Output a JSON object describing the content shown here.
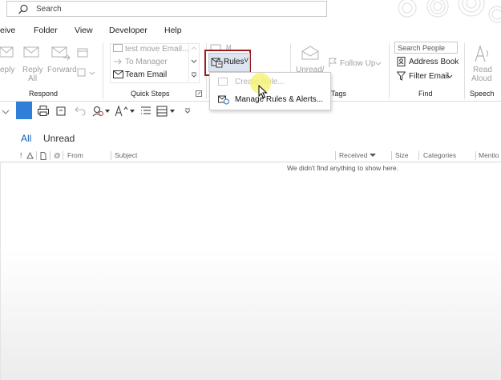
{
  "search": {
    "placeholder": "Search"
  },
  "menu": {
    "items": [
      "eive",
      "Folder",
      "View",
      "Developer",
      "Help"
    ]
  },
  "ribbon": {
    "respond": {
      "reply": "eply",
      "reply_all_1": "Reply",
      "reply_all_2": "All",
      "forward": "Forward",
      "group": "Respond"
    },
    "quick_steps": {
      "items": [
        "test move Email...",
        "To Manager",
        "Team Email"
      ],
      "group": "Quick Steps"
    },
    "rules": {
      "label": "Rules",
      "caret": "˅"
    },
    "tags": {
      "unread": "Unread/",
      "follow_up": "Follow Up",
      "group": "Tags"
    },
    "find": {
      "search_people": "Search People",
      "address_book": "Address Book",
      "filter_email": "Filter Email",
      "group": "Find"
    },
    "speech": {
      "read": "Read",
      "aloud": "Aloud",
      "group": "Speech"
    }
  },
  "dropdown": {
    "create_rule": "Create Rule...",
    "manage_rules": "Manage Rules & Alerts..."
  },
  "list": {
    "tabs": {
      "all": "All",
      "unread": "Unread"
    },
    "columns": {
      "from": "From",
      "subject": "Subject",
      "received": "Received",
      "size": "Size",
      "categories": "Categories",
      "mentions": "Mentio"
    },
    "empty_message": "We didn't find anything to show here."
  },
  "colors": {
    "accent": "#0a63b3",
    "highlight_border": "#9b1c1c",
    "cursor_halo": "#f7f27a"
  }
}
